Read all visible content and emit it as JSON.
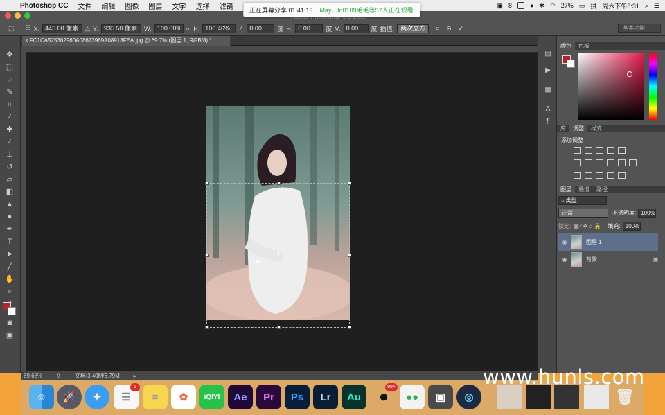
{
  "menubar": {
    "app": "Photoshop CC",
    "items": [
      "文件",
      "编辑",
      "图像",
      "图层",
      "文字",
      "选择",
      "滤镜",
      "3D"
    ],
    "status_count": "8",
    "battery": "27%",
    "clock": "周六下午8:31"
  },
  "share_banner": {
    "text_a": "正在屏幕分享 01:41:13",
    "text_b": "May、lq0109毛毛等57人正在观看"
  },
  "window_title": "Adobe Photoshop CC 2015",
  "options": {
    "x_label": "X:",
    "x_value": "445.00 像素",
    "y_label": "Y:",
    "y_value": "935.50 像素",
    "w_label": "W:",
    "w_value": "100.00%",
    "h_label": "H:",
    "h_value": "106.46%",
    "angle_value": "0.00",
    "angle_unit": "度",
    "hskew_label": "H:",
    "hskew_value": "0.00",
    "hskew_unit": "度",
    "vskew_label": "V:",
    "vskew_value": "0.00",
    "vskew_unit": "度",
    "interp_label": "插值:",
    "interp_value": "两次立方",
    "workspace": "基本功能"
  },
  "document": {
    "tab_title": "FC1CA525362960A08673969A08918FEA.jpg @ 69.7% (图层 1, RGB/8) *",
    "zoom": "69.68%",
    "doc_size": "文档:3.40M/6.79M"
  },
  "panels": {
    "color_tabs": [
      "颜色",
      "色板"
    ],
    "adjust_tabs": [
      "库",
      "调整",
      "样式"
    ],
    "adjust_title": "添加调整",
    "layers_tabs": [
      "图层",
      "通道",
      "路径"
    ],
    "kind_filter": "类型",
    "blend_mode": "正常",
    "opacity_label": "不透明度:",
    "opacity_value": "100%",
    "lock_label": "锁定:",
    "fill_label": "填充:",
    "fill_value": "100%",
    "layers": [
      {
        "name": "图层 1"
      },
      {
        "name": "背景"
      }
    ]
  },
  "dock": {
    "items": [
      "Finder",
      "Launchpad",
      "Safari",
      "Reminders",
      "Notes",
      "Photos",
      "iQIYI",
      "Ae",
      "Pr",
      "Ps",
      "Lr",
      "Au",
      "QQ",
      "WeChat",
      "Preview",
      "QuickTime"
    ],
    "ae": "Ae",
    "pr": "Pr",
    "ps": "Ps",
    "lr": "Lr",
    "au": "Au",
    "iqiyi": "iQIYI",
    "reminders_badge": "1",
    "qq_badge": "99+"
  },
  "watermark": "www.hunls.com",
  "colors": {
    "foreground": "#b4232e",
    "background": "#ffffff",
    "ps_blue": "#31a8ff",
    "ae_purple": "#9999ff",
    "pr_purple": "#e77cff"
  }
}
